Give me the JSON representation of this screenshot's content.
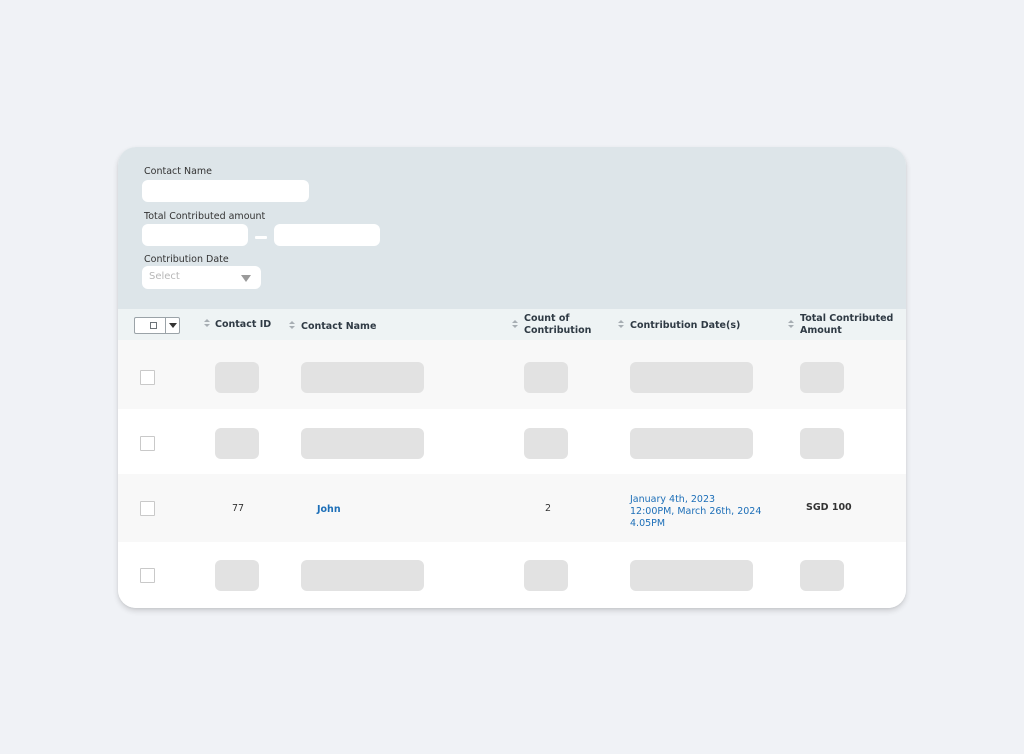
{
  "filters": {
    "contact_name_label": "Contact Name",
    "contact_name_value": "",
    "amount_label": "Total Contributed amount",
    "amount_min_value": "",
    "amount_max_value": "",
    "date_label": "Contribution Date",
    "date_placeholder": "Select"
  },
  "table": {
    "headers": {
      "contact_id": "Contact ID",
      "contact_name": "Contact Name",
      "count_line1": "Count of",
      "count_line2": "Contribution",
      "dates": "Contribution Date(s)",
      "total_line1": "Total Contributed",
      "total_line2": "Amount"
    },
    "rows": [
      {
        "loading": true
      },
      {
        "loading": true
      },
      {
        "contact_id": "77",
        "contact_name": "John",
        "count": "2",
        "dates": [
          "January 4th, 2023",
          "12:00PM, March 26th, 2024",
          "4.05PM"
        ],
        "total": "SGD 100"
      },
      {
        "loading": true
      }
    ]
  },
  "colors": {
    "filter_panel": "#dde5e9",
    "header": "#eef3f4",
    "link": "#1d6fb8",
    "skeleton": "#e2e2e2"
  }
}
